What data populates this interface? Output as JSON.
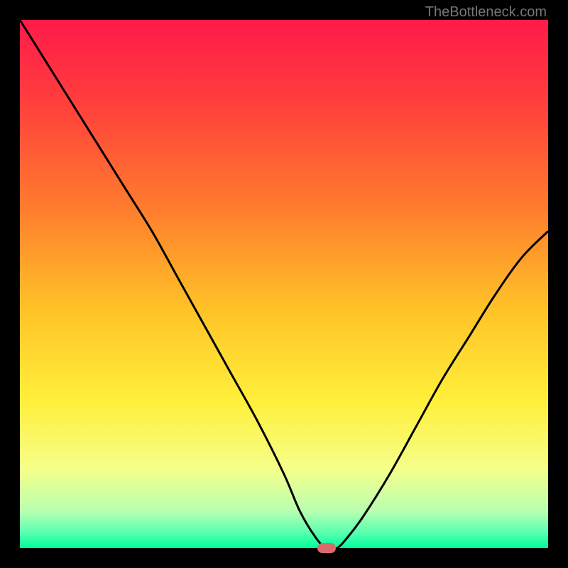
{
  "watermark": "TheBottleneck.com",
  "chart_data": {
    "type": "line",
    "title": "",
    "xlabel": "",
    "ylabel": "",
    "xlim": [
      0,
      100
    ],
    "ylim": [
      0,
      100
    ],
    "background_gradient": {
      "type": "vertical",
      "stops": [
        {
          "pos": 0.0,
          "color": "#ff1a4a"
        },
        {
          "pos": 0.15,
          "color": "#ff3d3d"
        },
        {
          "pos": 0.35,
          "color": "#ff7a2e"
        },
        {
          "pos": 0.55,
          "color": "#ffc327"
        },
        {
          "pos": 0.72,
          "color": "#ffef3a"
        },
        {
          "pos": 0.85,
          "color": "#f5ff8a"
        },
        {
          "pos": 0.93,
          "color": "#b8ffb0"
        },
        {
          "pos": 0.97,
          "color": "#5affb0"
        },
        {
          "pos": 1.0,
          "color": "#00ff9c"
        }
      ]
    },
    "series": [
      {
        "name": "bottleneck-curve",
        "color": "#000000",
        "x": [
          0,
          5,
          10,
          15,
          20,
          25,
          30,
          35,
          40,
          45,
          50,
          53,
          56,
          58,
          60,
          62,
          65,
          70,
          75,
          80,
          85,
          90,
          95,
          100
        ],
        "y": [
          100,
          92,
          84,
          76,
          68,
          60,
          51,
          42,
          33,
          24,
          14,
          7,
          2,
          0,
          0,
          2,
          6,
          14,
          23,
          32,
          40,
          48,
          55,
          60
        ]
      }
    ],
    "marker": {
      "name": "optimal-point",
      "x": 58,
      "y": 0,
      "color": "#d86b6b",
      "width_pct": 3.5,
      "height_pct": 1.8
    }
  }
}
